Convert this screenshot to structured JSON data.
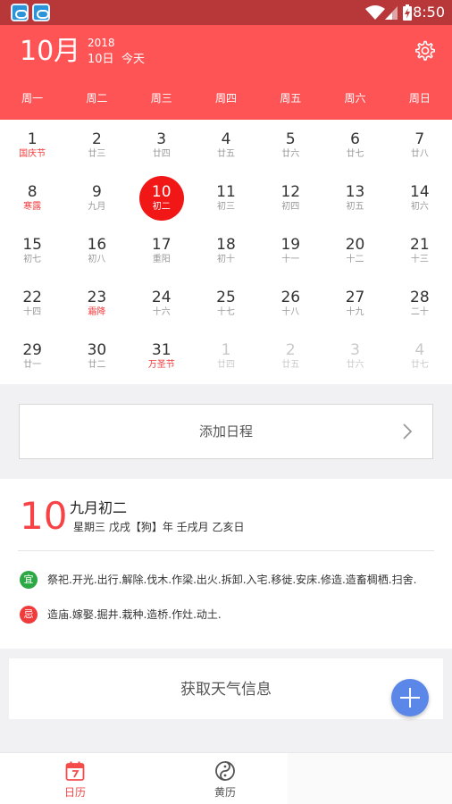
{
  "status_bar": {
    "time": "8:50",
    "battery_icon": "battery-charging-icon",
    "wifi_icon": "wifi-icon",
    "signal_icon": "signal-icon"
  },
  "header": {
    "month": "10月",
    "year": "2018",
    "day": "10日",
    "today": "今天",
    "settings_icon": "gear-icon"
  },
  "weekdays": [
    "周一",
    "周二",
    "周三",
    "周四",
    "周五",
    "周六",
    "周日"
  ],
  "calendar": {
    "weeks": [
      [
        {
          "day": "1",
          "sub": "国庆节",
          "festival": true
        },
        {
          "day": "2",
          "sub": "廿三"
        },
        {
          "day": "3",
          "sub": "廿四"
        },
        {
          "day": "4",
          "sub": "廿五"
        },
        {
          "day": "5",
          "sub": "廿六"
        },
        {
          "day": "6",
          "sub": "廿七"
        },
        {
          "day": "7",
          "sub": "廿八"
        }
      ],
      [
        {
          "day": "8",
          "sub": "寒露",
          "festival": true
        },
        {
          "day": "9",
          "sub": "九月"
        },
        {
          "day": "10",
          "sub": "初二",
          "selected": true
        },
        {
          "day": "11",
          "sub": "初三"
        },
        {
          "day": "12",
          "sub": "初四"
        },
        {
          "day": "13",
          "sub": "初五"
        },
        {
          "day": "14",
          "sub": "初六"
        }
      ],
      [
        {
          "day": "15",
          "sub": "初七"
        },
        {
          "day": "16",
          "sub": "初八"
        },
        {
          "day": "17",
          "sub": "重阳"
        },
        {
          "day": "18",
          "sub": "初十"
        },
        {
          "day": "19",
          "sub": "十一"
        },
        {
          "day": "20",
          "sub": "十二"
        },
        {
          "day": "21",
          "sub": "十三"
        }
      ],
      [
        {
          "day": "22",
          "sub": "十四"
        },
        {
          "day": "23",
          "sub": "霜降",
          "festival": true
        },
        {
          "day": "24",
          "sub": "十六"
        },
        {
          "day": "25",
          "sub": "十七"
        },
        {
          "day": "26",
          "sub": "十八"
        },
        {
          "day": "27",
          "sub": "十九"
        },
        {
          "day": "28",
          "sub": "二十"
        }
      ],
      [
        {
          "day": "29",
          "sub": "廿一"
        },
        {
          "day": "30",
          "sub": "廿二"
        },
        {
          "day": "31",
          "sub": "万圣节",
          "festival": true
        },
        {
          "day": "1",
          "sub": "廿四",
          "other": true
        },
        {
          "day": "2",
          "sub": "廿五",
          "other": true
        },
        {
          "day": "3",
          "sub": "廿六",
          "other": true
        },
        {
          "day": "4",
          "sub": "廿七",
          "other": true
        }
      ]
    ]
  },
  "add_schedule": {
    "label": "添加日程",
    "icon": "chevron-right-icon"
  },
  "almanac": {
    "day": "10",
    "lunar": "九月初二",
    "ganzhi": "星期三 戊戌【狗】年 壬戌月 乙亥日",
    "yi_badge": "宜",
    "yi_text": "祭祀.开光.出行.解除.伐木.作梁.出火.拆卸.入宅.移徙.安床.修造.造畜椆栖.扫舍.",
    "ji_badge": "忌",
    "ji_text": "造庙.嫁娶.掘井.栽种.造桥.作灶.动土."
  },
  "weather": {
    "label": "获取天气信息"
  },
  "fab": {
    "icon": "plus-icon"
  },
  "nav": {
    "calendar_label": "日历",
    "calendar_icon": "calendar-icon",
    "almanac_label": "黄历",
    "almanac_icon": "yin-yang-icon"
  },
  "colors": {
    "brand": "#fe5456",
    "selected": "#f11717",
    "festival": "#f23a3c",
    "fab": "#5b87e8",
    "yi": "#2ca845",
    "ji": "#ef3b3b"
  }
}
